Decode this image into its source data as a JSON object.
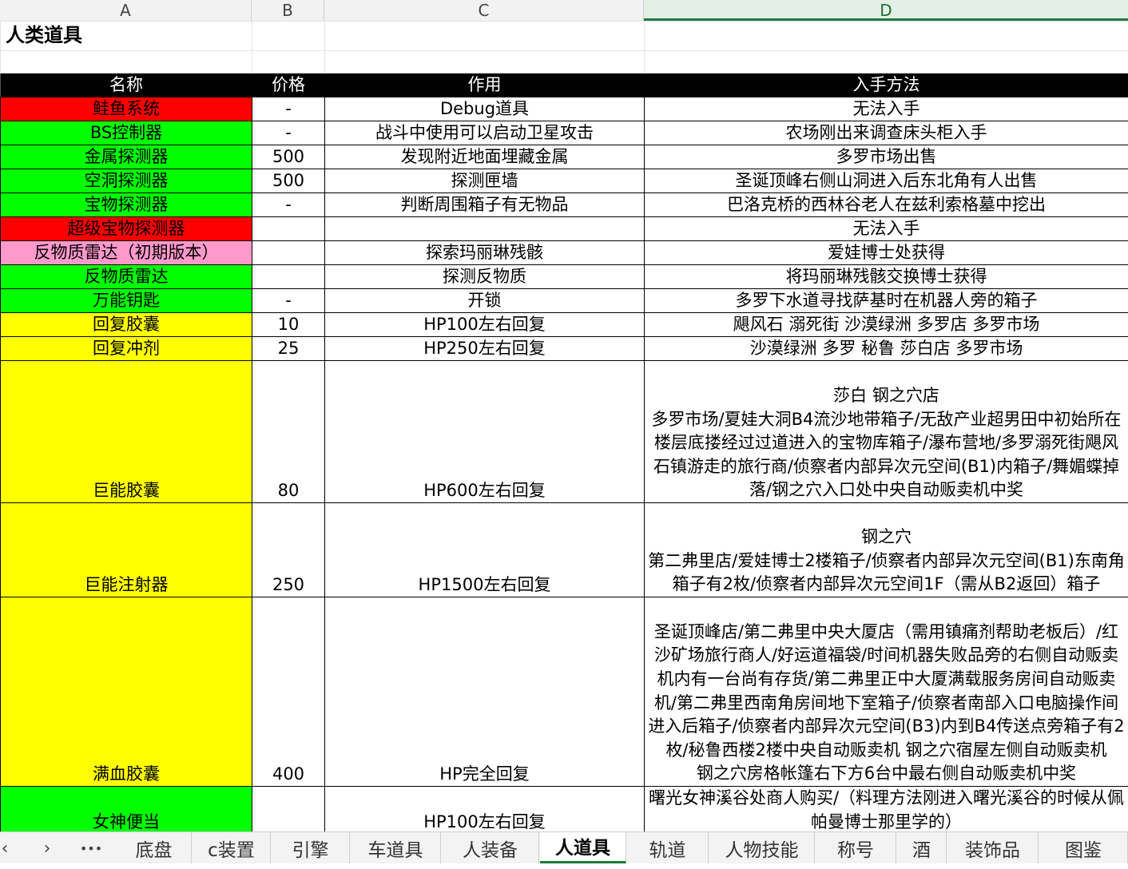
{
  "columns": [
    "A",
    "B",
    "C",
    "D"
  ],
  "title": "人类道具",
  "headers": {
    "name": "名称",
    "price": "价格",
    "effect": "作用",
    "obtain": "入手方法"
  },
  "colors": {
    "red": "#ff0000",
    "green": "#00ff00",
    "pink": "#ff99cc",
    "yellow": "#ffff00"
  },
  "rows": [
    {
      "name": "鲑鱼系统",
      "price": "-",
      "effect": "Debug道具",
      "obtain": "无法入手",
      "color": "#ff0000"
    },
    {
      "name": "BS控制器",
      "price": "-",
      "effect": "战斗中使用可以启动卫星攻击",
      "obtain": "农场刚出来调查床头柜入手",
      "color": "#00ff00"
    },
    {
      "name": "金属探测器",
      "price": "500",
      "effect": "发现附近地面埋藏金属",
      "obtain": "多罗市场出售",
      "color": "#00ff00"
    },
    {
      "name": "空洞探测器",
      "price": "500",
      "effect": "探测匣墙",
      "obtain": "圣诞顶峰右侧山洞进入后东北角有人出售",
      "color": "#00ff00"
    },
    {
      "name": "宝物探测器",
      "price": "-",
      "effect": "判断周围箱子有无物品",
      "obtain": "巴洛克桥的西林谷老人在兹利索格墓中挖出",
      "color": "#00ff00"
    },
    {
      "name": "超级宝物探测器",
      "price": "",
      "effect": "",
      "obtain": "无法入手",
      "color": "#ff0000"
    },
    {
      "name": "反物质雷达（初期版本）",
      "price": "",
      "effect": "探索玛丽琳残骸",
      "obtain": "爱娃博士处获得",
      "color": "#ff99cc"
    },
    {
      "name": "反物质雷达",
      "price": "",
      "effect": "探测反物质",
      "obtain": "将玛丽琳残骸交换博士获得",
      "color": "#00ff00"
    },
    {
      "name": "万能钥匙",
      "price": "-",
      "effect": "开锁",
      "obtain": "多罗下水道寻找萨基时在机器人旁的箱子",
      "color": "#00ff00"
    },
    {
      "name": "回复胶囊",
      "price": "10",
      "effect": "HP100左右回复",
      "obtain": "飓风石 溺死街 沙漠绿洲 多罗店 多罗市场",
      "color": "#ffff00"
    },
    {
      "name": "回复冲剂",
      "price": "25",
      "effect": "HP250左右回复",
      "obtain": "沙漠绿洲 多罗 秘鲁 莎白店 多罗市场",
      "color": "#ffff00"
    },
    {
      "name": "巨能胶囊",
      "price": "80",
      "effect": "HP600左右回复",
      "obtain": "莎白 钢之穴店\n多罗市场/夏娃大洞B4流沙地带箱子/无敌产业超男田中初始所在楼层底搂经过过道进入的宝物库箱子/瀑布营地/多罗溺死街飓风石镇游走的旅行商/侦察者内部异次元空间(B1)内箱子/舞媚蝶掉落/钢之穴入口处中央自动贩卖机中奖",
      "color": "#ffff00"
    },
    {
      "name": "巨能注射器",
      "price": "250",
      "effect": "HP1500左右回复",
      "obtain": "钢之穴\n第二弗里店/爱娃博士2楼箱子/侦察者内部异次元空间(B1)东南角箱子有2枚/侦察者内部异次元空间1F（需从B2返回）箱子",
      "color": "#ffff00"
    },
    {
      "name": "满血胶囊",
      "price": "400",
      "effect": "HP完全回复",
      "obtain": "圣诞顶峰店/第二弗里中央大厦店（需用镇痛剂帮助老板后）/红沙矿场旅行商人/好运道福袋/时间机器失败品旁的右侧自动贩卖机内有一台尚有存货/第二弗里正中大厦满载服务房间自动贩卖机/第二弗里西南角房间地下室箱子/侦察者南部入口电脑操作间进入后箱子/侦察者内部异次元空间(B3)内到B4传送点旁箱子有2枚/秘鲁西楼2楼中央自动贩卖机 钢之穴宿屋左侧自动贩卖机\n钢之穴房格帐篷右下方6台中最右侧自动贩卖机中奖",
      "color": "#ffff00"
    },
    {
      "name": "女神便当",
      "price": "",
      "effect": "HP100左右回复",
      "obtain": "曙光女神溪谷处商人购买/（料理方法刚进入曙光溪谷的时候从佩帕曼博士那里学的）",
      "color": "#00ff00"
    }
  ],
  "tabs": [
    "底盘",
    "c装置",
    "引擎",
    "车道具",
    "人装备",
    "人道具",
    "轨道",
    "人物技能",
    "称号",
    "酒",
    "装饰品",
    "图鉴"
  ],
  "active_tab": "人道具",
  "nav": {
    "prev": "‹",
    "next": "›",
    "more": "•••"
  }
}
